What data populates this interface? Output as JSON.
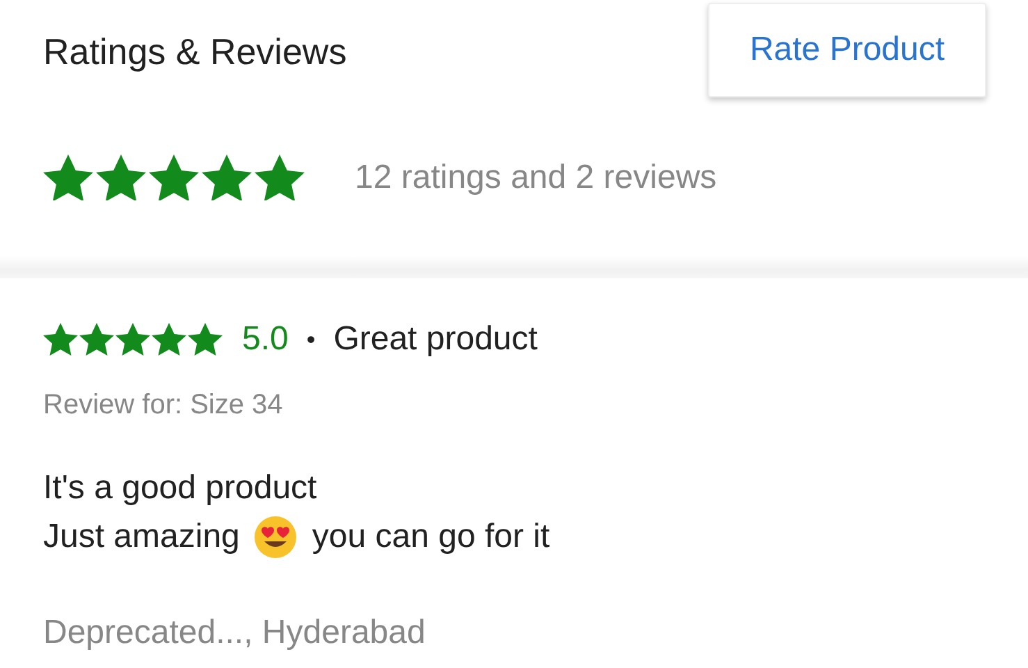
{
  "header": {
    "title": "Ratings & Reviews",
    "rate_button": "Rate Product"
  },
  "summary": {
    "stars": 5,
    "text": "12 ratings and 2 reviews"
  },
  "reviews": [
    {
      "stars": 5,
      "rating": "5.0",
      "separator": "•",
      "title": "Great product",
      "review_for": "Review for: Size 34",
      "lines": [
        {
          "parts": [
            {
              "kind": "text",
              "text": "It's a good product"
            }
          ]
        },
        {
          "parts": [
            {
              "kind": "text",
              "text": "Just amazing"
            },
            {
              "kind": "emoji"
            },
            {
              "kind": "text",
              "text": "you can go for it"
            }
          ]
        }
      ],
      "author": "Deprecated..., Hyderabad"
    }
  ]
}
